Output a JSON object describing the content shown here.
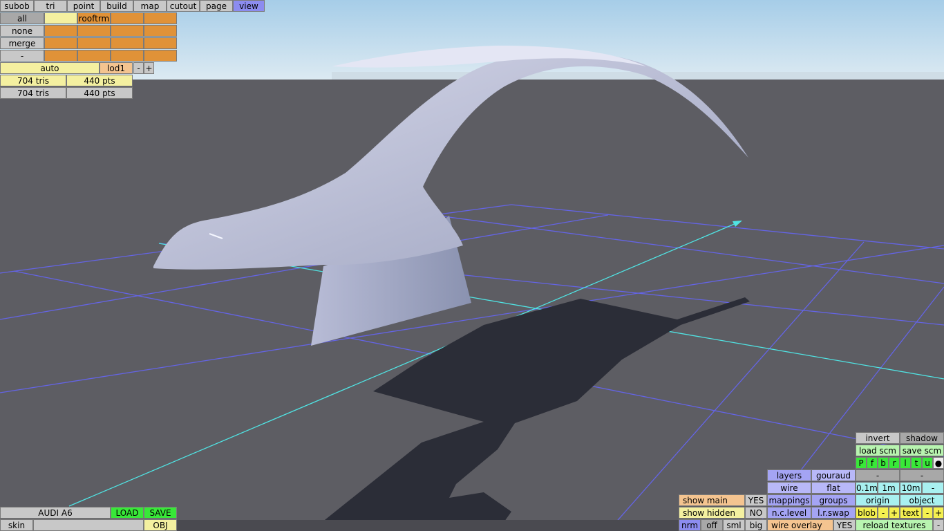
{
  "top_menu": [
    "subob",
    "tri",
    "point",
    "build",
    "map",
    "cutout",
    "page",
    "view"
  ],
  "active_menu": "view",
  "layer_rows": [
    {
      "label": "all",
      "cells": [
        "",
        "rooftrm",
        "",
        ""
      ]
    },
    {
      "label": "none",
      "cells": [
        "",
        "",
        "",
        ""
      ]
    },
    {
      "label": "merge",
      "cells": [
        "",
        "",
        "",
        ""
      ]
    },
    {
      "label": "-",
      "cells": [
        "",
        "",
        "",
        ""
      ]
    }
  ],
  "lod": {
    "mode": "auto",
    "level": "lod1",
    "minus": "-",
    "plus": "+"
  },
  "stats": [
    {
      "tris": "704 tris",
      "pts": "440 pts"
    },
    {
      "tris": "704 tris",
      "pts": "440 pts"
    }
  ],
  "file": {
    "name": "AUDI A6",
    "load": "LOAD",
    "save": "SAVE",
    "skin": "skin",
    "skin_value": "",
    "obj": "OBJ"
  },
  "right_panel": {
    "invert": "invert",
    "shadow": "shadow",
    "load_scm": "load scm",
    "save_scm": "save scm",
    "views": [
      "P",
      "f",
      "b",
      "r",
      "l",
      "t",
      "u",
      "●"
    ],
    "layers": "layers",
    "gouraud": "gouraud",
    "dash1": "-",
    "dash2": "-",
    "wire": "wire",
    "flat": "flat",
    "grid": [
      "0.1m",
      "1m",
      "10m",
      "-"
    ],
    "show_main": "show main",
    "show_main_val": "YES",
    "mappings": "mappings",
    "groups": "groups",
    "origin": "origin",
    "object": "object",
    "show_hidden": "show hidden",
    "show_hidden_val": "NO",
    "nc_level": "n.c.level",
    "lr_swap": "l.r.swap",
    "blob": "blob",
    "blob_minus": "-",
    "blob_plus": "+",
    "text": "text",
    "text_minus": "-",
    "text_plus": "+",
    "size": [
      "nrm",
      "off",
      "sml",
      "big"
    ],
    "wire_overlay": "wire overlay",
    "wire_overlay_val": "YES",
    "reload_textures": "reload textures",
    "reload_dash": "-"
  },
  "colors": {
    "background": "#5d5d63",
    "grid": "#6060e0",
    "axis": "#4fe0e0",
    "model": "#c4c6dc",
    "shadow": "#2a2c36"
  }
}
